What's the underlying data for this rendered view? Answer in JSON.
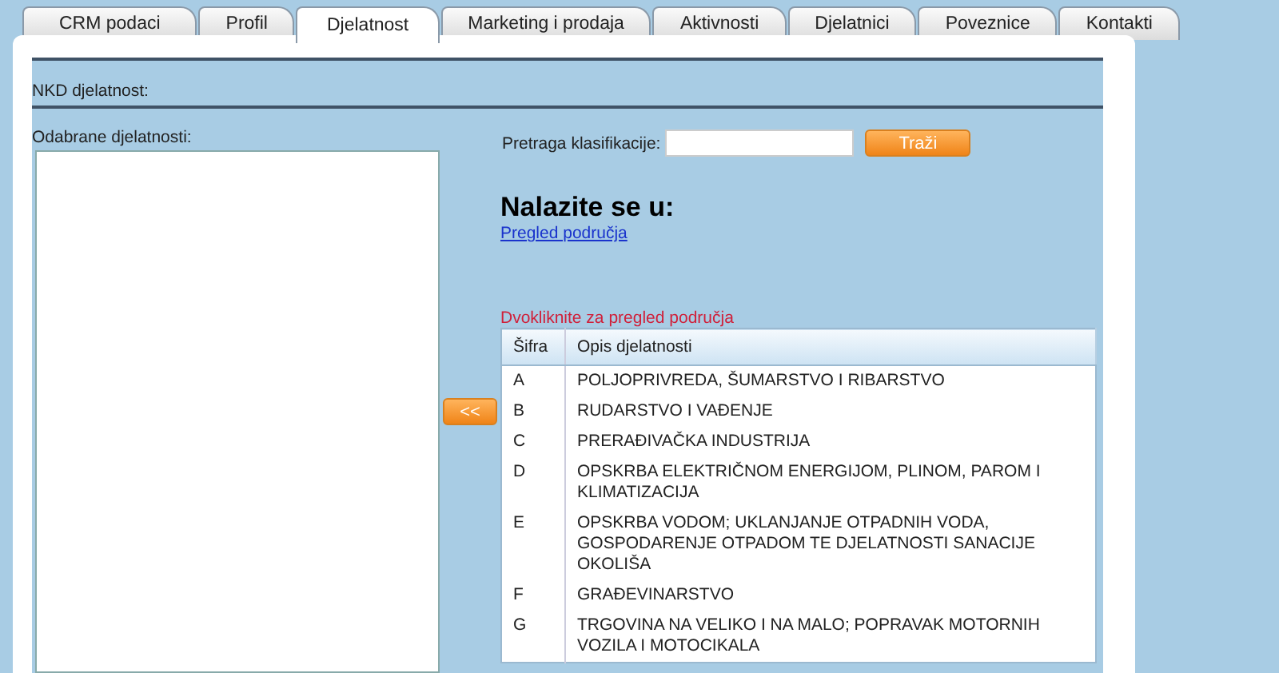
{
  "tabs": [
    {
      "label": "CRM podaci",
      "selected": false
    },
    {
      "label": "Profil",
      "selected": false
    },
    {
      "label": "Djelatnost",
      "selected": true
    },
    {
      "label": "Marketing i prodaja",
      "selected": false
    },
    {
      "label": "Aktivnosti",
      "selected": false
    },
    {
      "label": "Djelatnici",
      "selected": false
    },
    {
      "label": "Poveznice",
      "selected": false
    },
    {
      "label": "Kontakti",
      "selected": false
    }
  ],
  "section_title": "NKD djelatnost:",
  "selected_list": {
    "label": "Odabrane djelatnosti:"
  },
  "move_button": "<<",
  "search": {
    "label": "Pretraga klasifikacije:",
    "button": "Traži"
  },
  "location": {
    "heading": "Nalazite se u:",
    "link": "Pregled područja"
  },
  "hint": "Dvokliknite za pregled područja",
  "table": {
    "columns": [
      "Šifra",
      "Opis djelatnosti"
    ],
    "rows": [
      {
        "code": "A",
        "description": "POLJOPRIVREDA, ŠUMARSTVO I RIBARSTVO"
      },
      {
        "code": "B",
        "description": "RUDARSTVO I VAĐENJE"
      },
      {
        "code": "C",
        "description": "PRERAĐIVAČKA INDUSTRIJA"
      },
      {
        "code": "D",
        "description": "OPSKRBA ELEKTRIČNOM ENERGIJOM, PLINOM, PAROM I KLIMATIZACIJA"
      },
      {
        "code": "E",
        "description": "OPSKRBA VODOM; UKLANJANJE OTPADNIH VODA, GOSPODARENJE OTPADOM TE DJELATNOSTI SANACIJE OKOLIŠA"
      },
      {
        "code": "F",
        "description": "GRAĐEVINARSTVO"
      },
      {
        "code": "G",
        "description": "TRGOVINA NA VELIKO I NA MALO; POPRAVAK MOTORNIH VOZILA I MOTOCIKALA"
      }
    ]
  }
}
